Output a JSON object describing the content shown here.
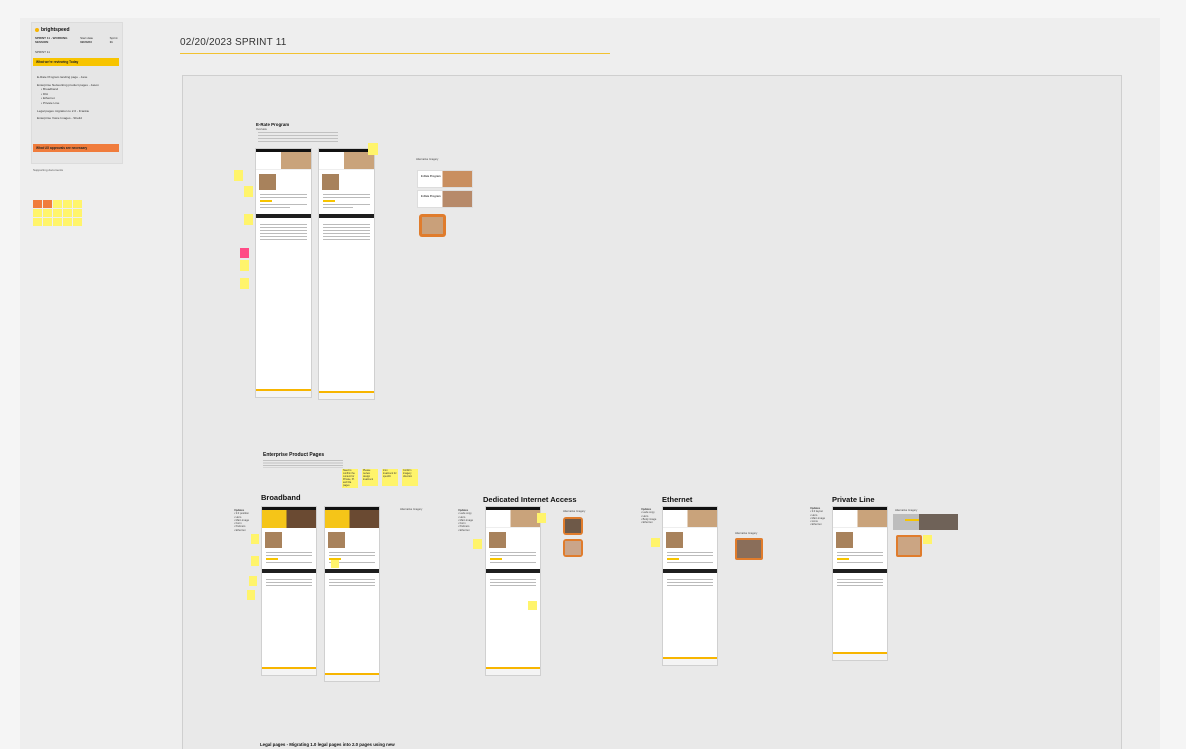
{
  "board": {
    "title": "02/20/2023 SPRINT 11"
  },
  "doc_card": {
    "brand": "brightspeed",
    "heading": "SPRINT 11 - WORKING SESSION",
    "meta": [
      {
        "label": "Start date",
        "value": "02/20/23"
      },
      {
        "label": "Sprint",
        "value": "11"
      }
    ],
    "sprint_label": "SPRINT 11",
    "working_bar": "What we're reviewing Today",
    "items": [
      "E-Rate Program landing page - Jane",
      "Enterprise Networking product pages - Jason",
      "Legal pages migration to 2.0 - Frankie",
      "Enterprise Voice Images - Sheild"
    ],
    "sub_items": [
      "Broadband",
      "DIA",
      "Ethernet",
      "Private Line"
    ],
    "approvals_bar": "What UX approvals are necessary",
    "support_label": "Supporting documents"
  },
  "erate": {
    "title": "E-Rate Program",
    "desc_label": "Overview",
    "alt_label": "Alternative Imagery",
    "alt_thumbs": [
      "E-Rate Program",
      "E-Rate Program"
    ]
  },
  "enterprise": {
    "title": "Enterprise Product Pages",
    "stickies": [
      "Need to confirm the content for Private, Pl. and Dia pages",
      "Please review design treatment",
      "Icon treatment for specific",
      "Confirm imagery direction"
    ]
  },
  "products": [
    {
      "title": "Broadband",
      "updates_label": "Updates",
      "updates": [
        "3.0 position",
        "Hero",
        "Main image",
        "Form",
        "Partners",
        "Ethernet"
      ],
      "alt_label": "Alternative Imagery"
    },
    {
      "title": "Dedicated Internet Access",
      "updates_label": "Updates",
      "updates": [
        "Lede copy",
        "Hero",
        "Main image",
        "Form",
        "Partners",
        "Ethernet"
      ],
      "alt_label": "Alternative Imagery"
    },
    {
      "title": "Ethernet",
      "updates_label": "Updates",
      "updates": [
        "Lede copy",
        "Hero",
        "Body image",
        "Ethernet"
      ],
      "alt_label": "Alternative Imagery"
    },
    {
      "title": "Private Line",
      "updates_label": "Updates",
      "updates": [
        "3.0 layout",
        "Hero",
        "Main image",
        "Icons",
        "Ethernet"
      ],
      "alt_label": "Alternative Imagery"
    }
  ],
  "legal": {
    "title": "Legal pages - Migrating 1.0 legal pages into 2.0 pages using new"
  },
  "colors": {
    "yellow": "#f7c400",
    "orange": "#f07c3c",
    "sticky": "#fff46b",
    "pink": "#ff4b86"
  }
}
